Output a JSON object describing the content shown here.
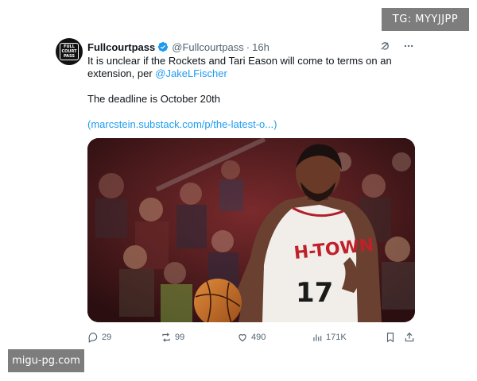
{
  "watermarks": {
    "top_right": "TG: MYYJJPP",
    "bottom_left": "migu-pg.com"
  },
  "tweet": {
    "display_name": "Fullcourtpass",
    "handle": "@Fullcourtpass",
    "separator": "·",
    "time": "16h",
    "text_line1": "It is unclear if the Rockets and Tari Eason will come to terms on an extension, per ",
    "mention": "@JakeLFischer",
    "text_line2": "The deadline is October 20th",
    "link_open": "(",
    "link": "marcstein.substack.com/p/the-latest-o...",
    "link_close": ")",
    "avatar_text": [
      "FULL",
      "COURT",
      "PASS"
    ],
    "jersey_text": "H-TOWN",
    "jersey_number": "17",
    "stats": {
      "replies": "29",
      "reposts": "99",
      "likes": "490",
      "views": "171K"
    }
  },
  "colors": {
    "accent": "#1d9bf0",
    "muted": "#536471",
    "badge": "#7d7d7d"
  },
  "icons": [
    "verified-badge-icon",
    "grok-icon",
    "more-icon",
    "reply-icon",
    "repost-icon",
    "like-icon",
    "views-icon",
    "bookmark-icon",
    "share-icon"
  ]
}
